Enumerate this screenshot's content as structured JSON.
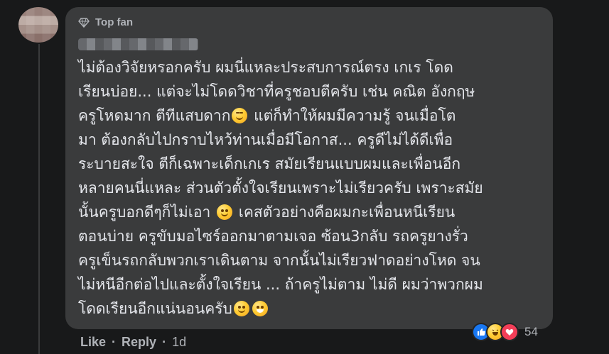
{
  "comment": {
    "badge": "Top fan",
    "text_lines": [
      "ไม่ต้องวิจัยหรอกครับ ผมนี่แหละประสบการณ์ตรง เกเร โดด",
      "เรียนบ่อย... แต่จะไม่โดดวิชาที่ครูชอบตีครับ เช่น คณิต อังกฤษ",
      "ครูโหดมาก ตีทีแสบดาก",
      "แต่ก็ทำให้ผมมีความรู้ จนเมื่อโต",
      "มา ต้องกลับไปกราบไหว้ท่านเมื่อมีโอกาส... ครูดีไม่ได้ดีเพื่อ",
      "ระบายสะใจ ตีก็เฉพาะเด็กเกเร สมัยเรียนแบบผมและเพื่อนอีก",
      "หลายคนนี่แหละ ส่วนตัวตั้งใจเรียนเพราะไม่เรียวครับ เพราะสมัย",
      "นั้นครูบอกดีๆก็ไม่เอา",
      "เคสตัวอย่างคือผมกะเพื่อนหนีเรียน",
      "ตอนบ่าย ครูขับมอไซร์ออกมาตามเจอ ซ้อน3กลับ รถครูยางรั่ว",
      "ครูเข็นรถกลับพวกเราเดินตาม จากนั้นไม่เรียวฟาดอย่างโหด จน",
      "ไม่หนีอีกต่อไปและตั้งใจเรียน ... ถ้าครูไม่ตาม ไม่ดี ผมว่าพวกผม",
      "โดดเรียนอีกแน่นอนครับ"
    ]
  },
  "actions": {
    "like": "Like",
    "reply": "Reply",
    "sep": "·",
    "time": "1d"
  },
  "reactions": {
    "count": "54",
    "types": [
      "like-icon",
      "haha-icon",
      "love-icon"
    ]
  },
  "colors": {
    "background": "#18191a",
    "bubble": "#3a3b3c",
    "text": "#e4e6eb",
    "secondary": "#b0b3b8",
    "like": "#1877f2",
    "love": "#f33e58"
  }
}
